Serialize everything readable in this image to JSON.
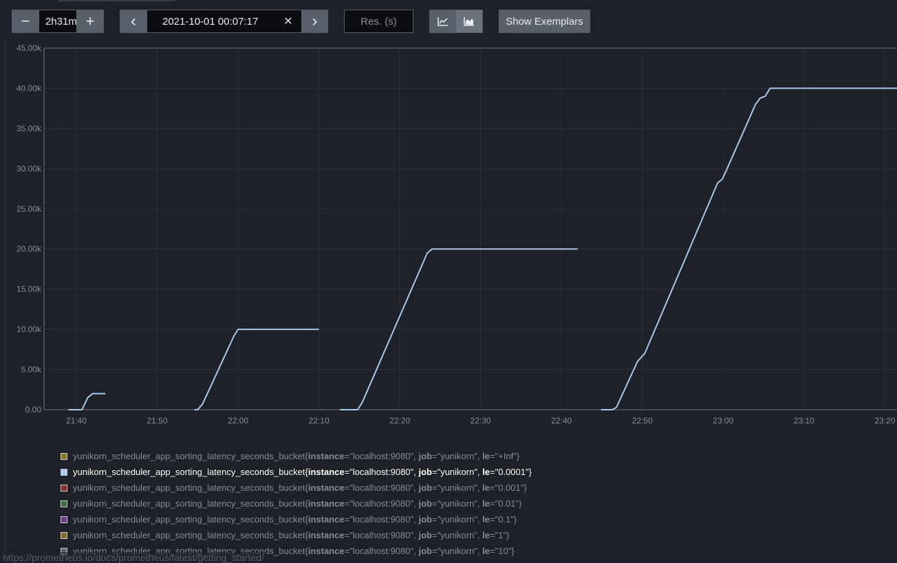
{
  "toolbar": {
    "range_minus": "−",
    "range_value": "2h31m",
    "range_plus": "+",
    "end_prev": "‹",
    "end_time": "2021-10-01 00:07:17",
    "end_clear": "✕",
    "end_next": "›",
    "resolution_placeholder": "Res. (s)",
    "line_chart_icon": "line-chart-icon",
    "stacked_chart_icon": "stacked-area-chart-icon",
    "exemplars_label": "Show Exemplars"
  },
  "colors": {
    "background": "#1e2127",
    "plot_line": "#a9c9ef",
    "grid": "#2e3238",
    "axis": "#6b7078"
  },
  "chart_data": {
    "type": "line",
    "ylim": [
      0,
      45000
    ],
    "yticks": [
      "0.00",
      "5.00k",
      "10.00k",
      "15.00k",
      "20.00k",
      "25.00k",
      "30.00k",
      "35.00k",
      "40.00k",
      "45.00k"
    ],
    "xticks": [
      "21:40",
      "21:50",
      "22:00",
      "22:10",
      "22:20",
      "22:30",
      "22:40",
      "22:50",
      "23:00",
      "23:10",
      "23:20"
    ],
    "xlim": [
      "21:36",
      "23:21.5"
    ],
    "grid": true,
    "series": [
      {
        "segments": [
          [
            [
              "21:39",
              0
            ],
            [
              "21:40.7",
              0
            ],
            [
              "21:41.4",
              1500
            ],
            [
              "21:42",
              2000
            ],
            [
              "21:43.6",
              2000
            ]
          ],
          [
            [
              "21:54.6",
              0
            ],
            [
              "21:55",
              0
            ],
            [
              "21:55.6",
              700
            ],
            [
              "21:59.5",
              9200
            ],
            [
              "22:00",
              10000
            ],
            [
              "22:10",
              10000
            ]
          ],
          [
            [
              "22:12.6",
              0
            ],
            [
              "22:14.8",
              0
            ],
            [
              "22:15.4",
              1000
            ],
            [
              "22:23.4",
              19500
            ],
            [
              "22:24",
              20000
            ],
            [
              "22:42",
              20000
            ]
          ],
          [
            [
              "22:44.9",
              0
            ],
            [
              "22:46.3",
              0
            ],
            [
              "22:46.8",
              300
            ],
            [
              "22:49.4",
              6000
            ],
            [
              "22:50.3",
              7000
            ],
            [
              "22:59.3",
              28200
            ],
            [
              "22:59.9",
              28700
            ],
            [
              "23:00.4",
              29800
            ],
            [
              "23:04",
              38000
            ],
            [
              "23:04.6",
              38800
            ],
            [
              "23:05.2",
              39000
            ],
            [
              "23:05.8",
              40000
            ],
            [
              "23:21.5",
              40000
            ]
          ]
        ]
      }
    ]
  },
  "legend": {
    "items": [
      {
        "metric": "yunikorn_scheduler_app_sorting_latency_seconds_bucket",
        "instance": "localhost:9080",
        "job": "yunikorn",
        "le": "+Inf",
        "color": "#8a7a1e",
        "active": false
      },
      {
        "metric": "yunikorn_scheduler_app_sorting_latency_seconds_bucket",
        "instance": "localhost:9080",
        "job": "yunikorn",
        "le": "0.0001",
        "color": "#a9c9ef",
        "active": true
      },
      {
        "metric": "yunikorn_scheduler_app_sorting_latency_seconds_bucket",
        "instance": "localhost:9080",
        "job": "yunikorn",
        "le": "0.001",
        "color": "#8b2a2a",
        "active": false
      },
      {
        "metric": "yunikorn_scheduler_app_sorting_latency_seconds_bucket",
        "instance": "localhost:9080",
        "job": "yunikorn",
        "le": "0.01",
        "color": "#3d6e3a",
        "active": false
      },
      {
        "metric": "yunikorn_scheduler_app_sorting_latency_seconds_bucket",
        "instance": "localhost:9080",
        "job": "yunikorn",
        "le": "0.1",
        "color": "#6b3a8f",
        "active": false
      },
      {
        "metric": "yunikorn_scheduler_app_sorting_latency_seconds_bucket",
        "instance": "localhost:9080",
        "job": "yunikorn",
        "le": "1",
        "color": "#8a6a28",
        "active": false
      },
      {
        "metric": "yunikorn_scheduler_app_sorting_latency_seconds_bucket",
        "instance": "localhost:9080",
        "job": "yunikorn",
        "le": "10",
        "color": "#5a6474",
        "active": false
      }
    ]
  },
  "status_url": "https://prometheus.io/docs/prometheus/latest/getting_started/"
}
